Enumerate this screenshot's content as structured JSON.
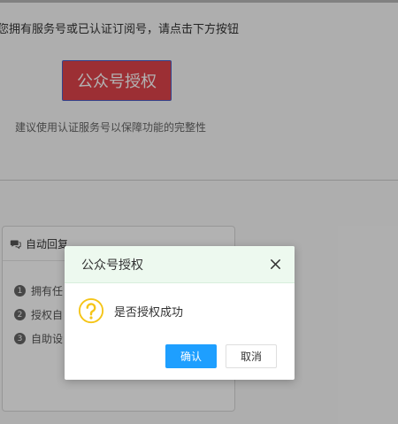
{
  "intro_text": "您拥有服务号或已认证订阅号，请点击下方按钮",
  "auth_button": "公众号授权",
  "hint_text": "建议使用认证服务号以保障功能的完整性",
  "panel": {
    "title": "自动回复",
    "steps": [
      {
        "num": "1",
        "label": "拥有任"
      },
      {
        "num": "2",
        "label": "授权自"
      },
      {
        "num": "3",
        "label": "自助设"
      }
    ]
  },
  "dialog": {
    "title": "公众号授权",
    "message": "是否授权成功",
    "confirm": "确认",
    "cancel": "取消"
  },
  "colors": {
    "auth_button": "#e0444b",
    "confirm": "#1e9fff",
    "question_icon": "#f5c518",
    "dialog_header": "#edf9ef"
  },
  "icons": [
    "chat-icon",
    "question-icon",
    "close-icon"
  ]
}
